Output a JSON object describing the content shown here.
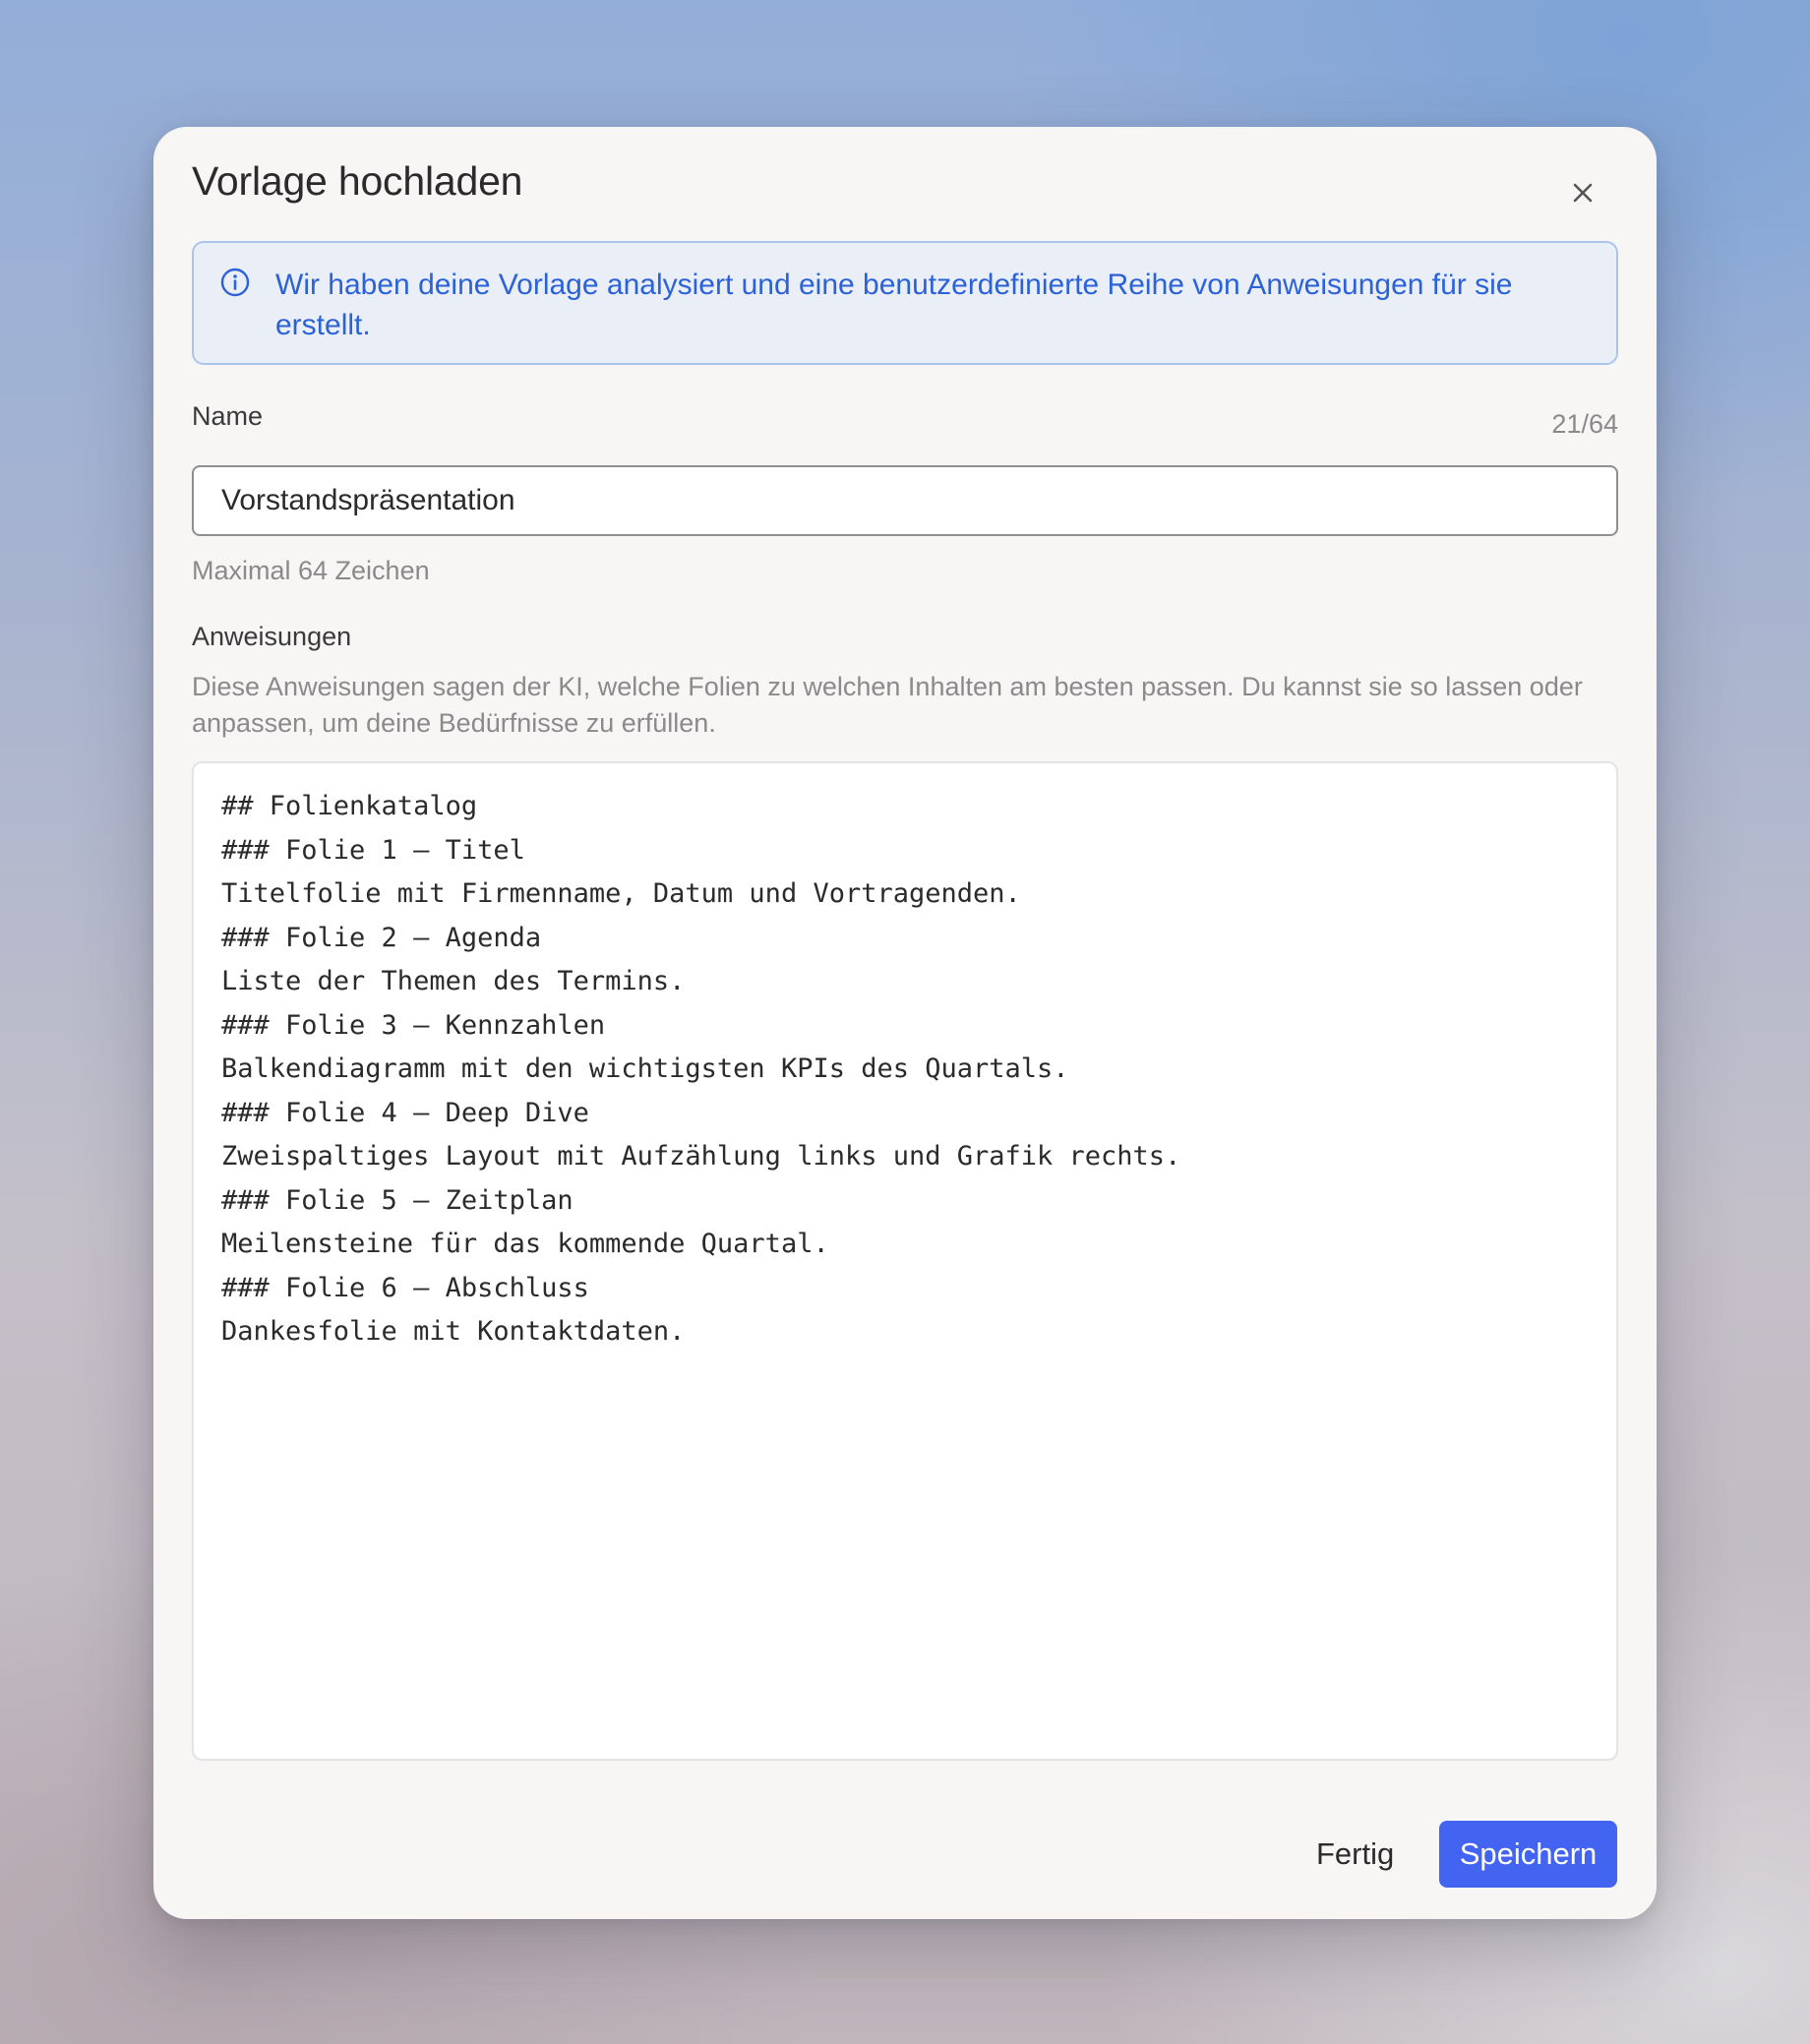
{
  "dialog": {
    "title": "Vorlage hochladen",
    "close_icon": "close-icon"
  },
  "info": {
    "icon": "info-circle-icon",
    "text": "Wir haben deine Vorlage analysiert und eine benutzerdefinierte Reihe von Anweisungen für sie erstellt.",
    "color": "#2c62d8"
  },
  "name_field": {
    "label": "Name",
    "counter": "21/64",
    "value": "Vorstandspräsentation",
    "hint": "Maximal 64 Zeichen"
  },
  "instructions": {
    "label": "Anweisungen",
    "description": "Diese Anweisungen sagen der KI, welche Folien zu welchen Inhalten am besten passen. Du kannst sie so lassen oder anpassen, um deine Bedürfnisse zu erfüllen.",
    "lines": [
      "## Folienkatalog",
      "### Folie 1 — Titel",
      "Titelfolie mit Firmenname, Datum und Vortragenden.",
      "### Folie 2 — Agenda",
      "Liste der Themen des Termins.",
      "### Folie 3 — Kennzahlen",
      "Balkendiagramm mit den wichtigsten KPIs des Quartals.",
      "### Folie 4 — Deep Dive",
      "Zweispaltiges Layout mit Aufzählung links und Grafik rechts.",
      "### Folie 5 — Zeitplan",
      "Meilensteine für das kommende Quartal.",
      "### Folie 6 — Abschluss",
      "Dankesfolie mit Kontaktdaten."
    ]
  },
  "footer": {
    "done_label": "Fertig",
    "save_label": "Speichern",
    "accent": "#4364f0"
  }
}
